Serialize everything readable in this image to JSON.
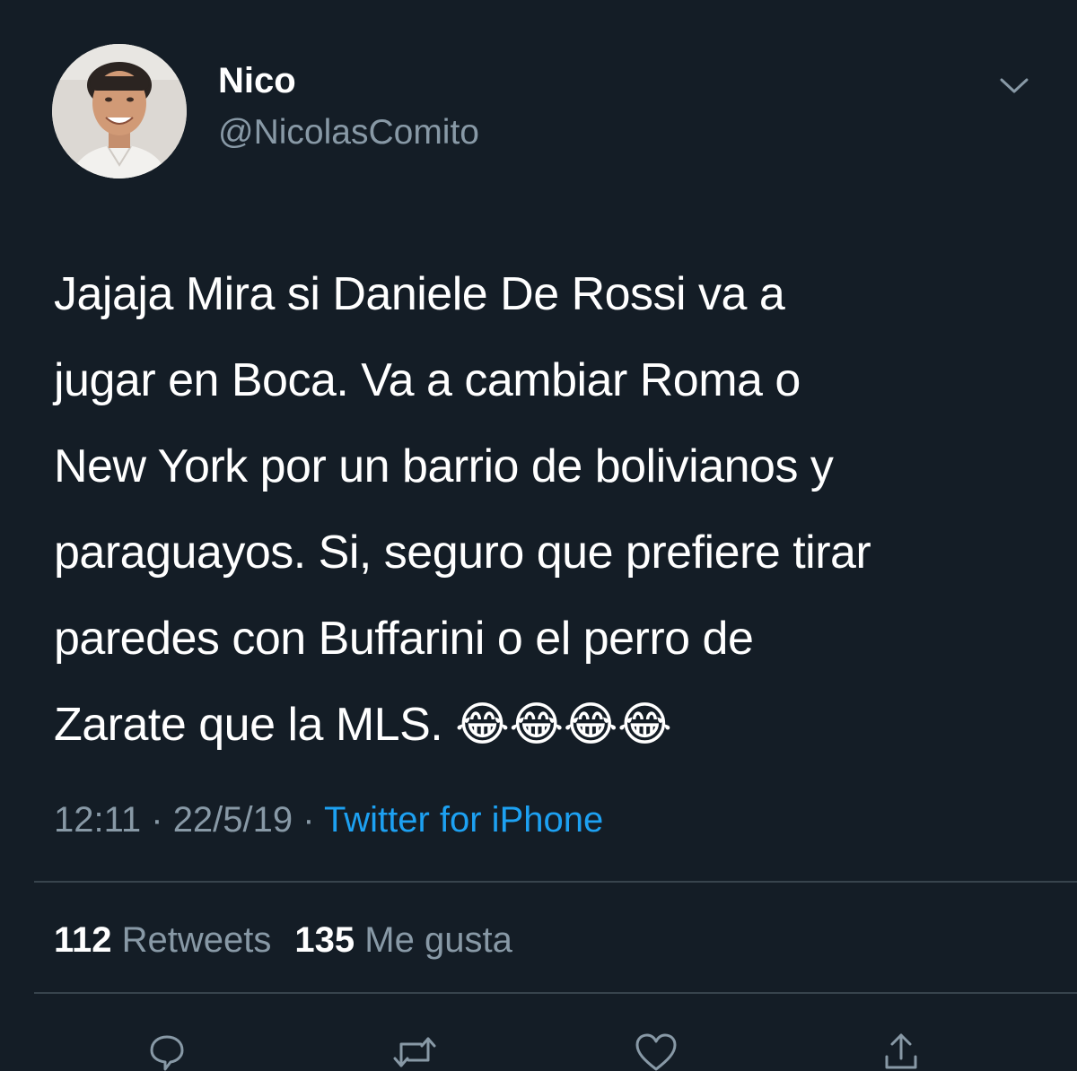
{
  "user": {
    "display_name": "Nico",
    "handle": "@NicolasComito",
    "avatar_icon": "user-avatar"
  },
  "tweet": {
    "text": "Jajaja Mira si Daniele De Rossi va a\njugar en Boca.  Va a cambiar Roma o\nNew York por un barrio de bolivianos y\nparaguayos. Si, seguro que prefiere tirar\nparedes con Buffarini o el perro de\nZarate que la MLS. 😂😂😂😂"
  },
  "meta": {
    "time": "12:11",
    "separator": " · ",
    "date": "22/5/19",
    "source": "Twitter for iPhone"
  },
  "stats": {
    "retweets_count": "112",
    "retweets_label": "Retweets",
    "likes_count": "135",
    "likes_label": "Me gusta"
  },
  "actions": [
    {
      "icon": "reply-icon"
    },
    {
      "icon": "retweet-icon"
    },
    {
      "icon": "like-icon"
    },
    {
      "icon": "share-icon"
    }
  ],
  "colors": {
    "background": "#141d26",
    "text_primary": "#ffffff",
    "text_secondary": "#8899a6",
    "accent": "#1da1f2",
    "divider": "#38444d"
  }
}
